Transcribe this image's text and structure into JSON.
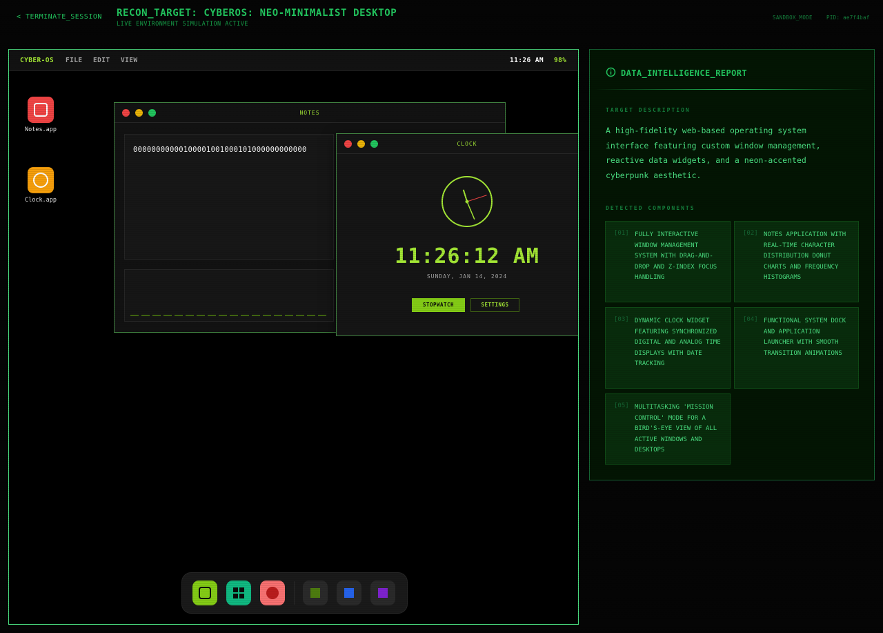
{
  "header": {
    "back_label": "< TERMINATE_SESSION",
    "title": "RECON_TARGET: CYBEROS: NEO-MINIMALIST DESKTOP",
    "subtitle": "LIVE ENVIRONMENT SIMULATION ACTIVE",
    "mode": "SANDBOX_MODE",
    "pid": "PID: ae7f4baf"
  },
  "desktop": {
    "menubar": {
      "brand": "CYBER-OS",
      "menus": [
        "FILE",
        "EDIT",
        "VIEW"
      ],
      "time": "11:26 AM",
      "battery": "98%"
    },
    "icons": [
      {
        "label": "Notes.app",
        "color": "#ef4444",
        "icon": "notes-icon"
      },
      {
        "label": "Clock.app",
        "color": "#f59e0b",
        "icon": "clock-icon"
      }
    ],
    "notes_window": {
      "title": "NOTES",
      "content": "00000000000100001001000101000000000000"
    },
    "clock_window": {
      "title": "CLOCK",
      "time": "11:26:12 AM",
      "date": "SUNDAY, JAN 14, 2024",
      "analog": {
        "hour": 11,
        "minute": 26,
        "second": 12
      },
      "stopwatch_label": "STOPWATCH",
      "settings_label": "SETTINGS"
    },
    "dock": [
      {
        "name": "notes",
        "color": "#84cc16",
        "icon": "square-icon"
      },
      {
        "name": "apps",
        "color": "#10b981",
        "icon": "grid-icon"
      },
      {
        "name": "record",
        "color": "#f87171",
        "icon": "circle-icon"
      },
      {
        "name": "app-green",
        "color": "#4d7c0f",
        "icon": "square-icon"
      },
      {
        "name": "app-blue",
        "color": "#2563eb",
        "icon": "square-icon"
      },
      {
        "name": "app-purple",
        "color": "#7e22ce",
        "icon": "square-icon"
      }
    ]
  },
  "report": {
    "title": "DATA_INTELLIGENCE_REPORT",
    "target_label": "TARGET DESCRIPTION",
    "description": "A high-fidelity web-based operating system interface featuring custom window management, reactive data widgets, and a neon-accented cyberpunk aesthetic.",
    "components_label": "DETECTED COMPONENTS",
    "components": [
      {
        "num": "[01]",
        "text": "FULLY INTERACTIVE WINDOW MANAGEMENT SYSTEM WITH DRAG-AND-DROP AND Z-INDEX FOCUS HANDLING"
      },
      {
        "num": "[02]",
        "text": "NOTES APPLICATION WITH REAL-TIME CHARACTER DISTRIBUTION DONUT CHARTS AND FREQUENCY HISTOGRAMS"
      },
      {
        "num": "[03]",
        "text": "DYNAMIC CLOCK WIDGET FEATURING SYNCHRONIZED DIGITAL AND ANALOG TIME DISPLAYS WITH DATE TRACKING"
      },
      {
        "num": "[04]",
        "text": "FUNCTIONAL SYSTEM DOCK AND APPLICATION LAUNCHER WITH SMOOTH TRANSITION ANIMATIONS"
      },
      {
        "num": "[05]",
        "text": "MULTITASKING 'MISSION CONTROL' MODE FOR A BIRD'S-EYE VIEW OF ALL ACTIVE WINDOWS AND DESKTOPS"
      }
    ]
  }
}
